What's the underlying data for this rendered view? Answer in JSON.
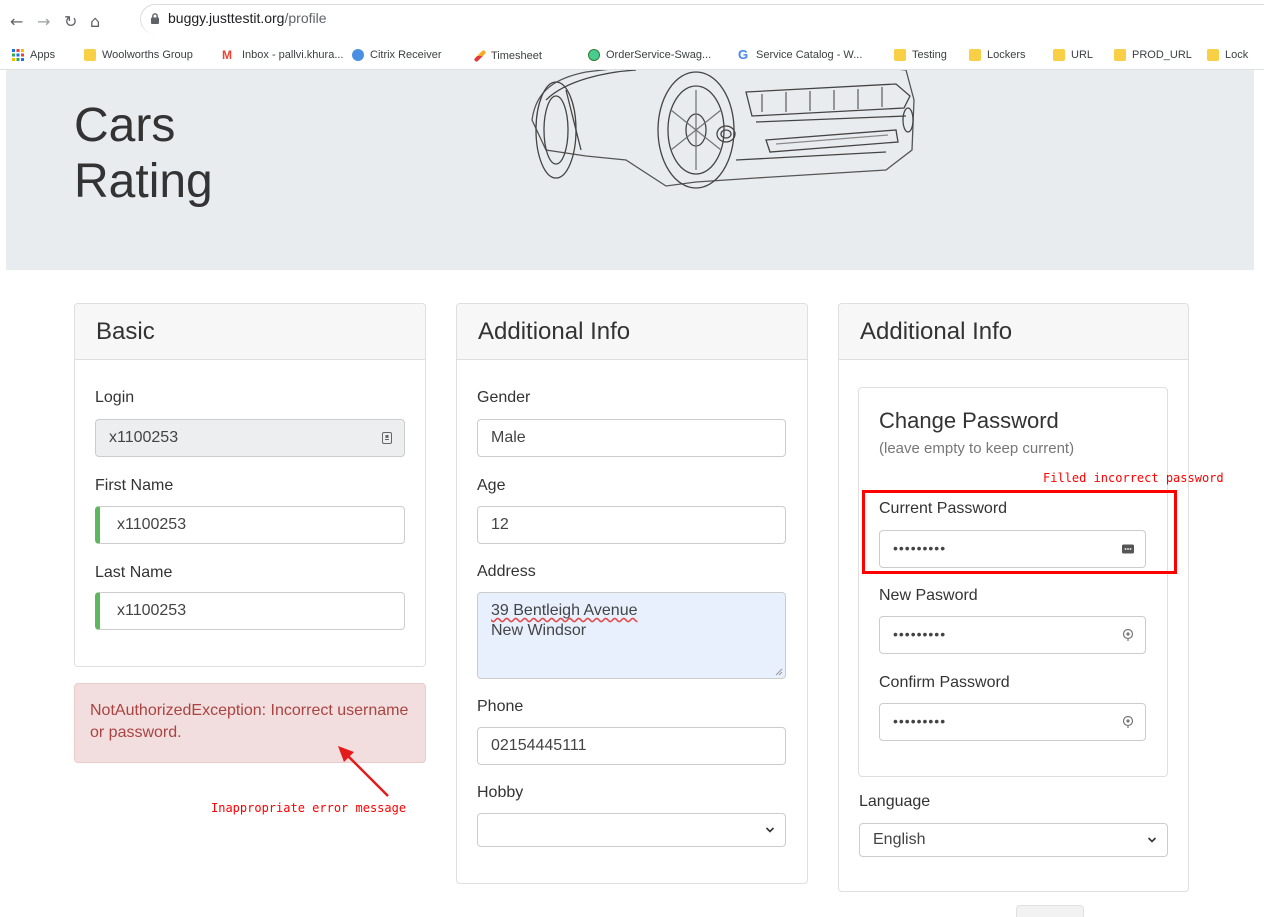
{
  "browser": {
    "url_host": "buggy.justtestit.org",
    "url_path": "/profile",
    "bookmarks": [
      {
        "label": "Apps"
      },
      {
        "label": "Woolworths Group"
      },
      {
        "label": "Inbox - pallvi.khura..."
      },
      {
        "label": "Citrix Receiver"
      },
      {
        "label": "Timesheet"
      },
      {
        "label": "OrderService-Swag..."
      },
      {
        "label": "Service Catalog - W..."
      },
      {
        "label": "Testing"
      },
      {
        "label": "Lockers"
      },
      {
        "label": "URL"
      },
      {
        "label": "PROD_URL"
      },
      {
        "label": "Lock"
      }
    ]
  },
  "hero": {
    "title_line1": "Cars",
    "title_line2": "Rating"
  },
  "basic": {
    "header": "Basic",
    "login_label": "Login",
    "login_value": "x1100253",
    "first_name_label": "First Name",
    "first_name_value": "x1100253",
    "last_name_label": "Last Name",
    "last_name_value": "x1100253"
  },
  "error": {
    "message": "NotAuthorizedException: Incorrect username or password."
  },
  "additional": {
    "header": "Additional Info",
    "gender_label": "Gender",
    "gender_value": "Male",
    "age_label": "Age",
    "age_value": "12",
    "address_label": "Address",
    "address_line1": "39 Bentleigh Avenue",
    "address_line2": "New Windsor",
    "phone_label": "Phone",
    "phone_value": "02154445111",
    "hobby_label": "Hobby",
    "hobby_value": ""
  },
  "password": {
    "header": "Additional Info",
    "title": "Change Password",
    "subtitle": "(leave empty to keep current)",
    "current_label": "Current Password",
    "current_value": "•••••••••",
    "new_label": "New Pasword",
    "new_value": "•••••••••",
    "confirm_label": "Confirm Password",
    "confirm_value": "•••••••••",
    "language_label": "Language",
    "language_value": "English"
  },
  "annotations": {
    "incorrect_password": "Filled incorrect password",
    "error_message": "Inappropriate error message",
    "color": "#ff0000"
  }
}
